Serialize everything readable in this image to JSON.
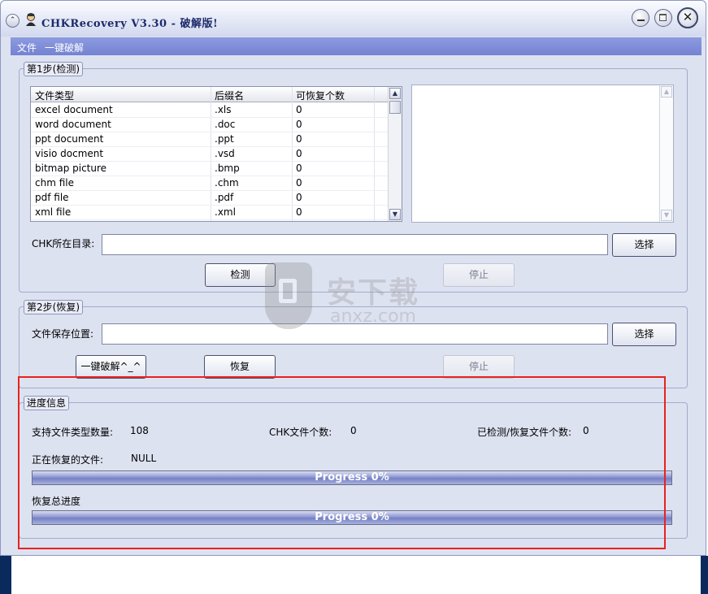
{
  "window": {
    "title": "CHKRecovery V3.30 - 破解版!"
  },
  "menu": {
    "items": [
      "文件",
      "一键破解"
    ]
  },
  "step1": {
    "legend": "第1步(检测)",
    "columns": [
      "文件类型",
      "后缀名",
      "可恢复个数"
    ],
    "rows": [
      [
        "excel document",
        ".xls",
        "0"
      ],
      [
        "word document",
        ".doc",
        "0"
      ],
      [
        "ppt document",
        ".ppt",
        "0"
      ],
      [
        "visio docment",
        ".vsd",
        "0"
      ],
      [
        "bitmap picture",
        ".bmp",
        "0"
      ],
      [
        "chm file",
        ".chm",
        "0"
      ],
      [
        "pdf file",
        ".pdf",
        "0"
      ],
      [
        "xml file",
        ".xml",
        "0"
      ]
    ],
    "dir_label": "CHK所在目录:",
    "dir_value": "",
    "browse_label": "选择",
    "detect_label": "检测",
    "stop_label": "停止"
  },
  "step2": {
    "legend": "第2步(恢复)",
    "save_label": "文件保存位置:",
    "save_value": "",
    "browse_label": "选择",
    "crack_label": "一键破解^_^",
    "recover_label": "恢复",
    "stop_label": "停止"
  },
  "progress": {
    "legend": "进度信息",
    "supported_label": "支持文件类型数量:",
    "supported_value": "108",
    "chk_count_label": "CHK文件个数:",
    "chk_count_value": "0",
    "checked_label": "已检测/恢复文件个数:",
    "checked_value": "0",
    "current_label": "正在恢复的文件:",
    "current_value": "NULL",
    "bar1_text": "Progress 0%",
    "bar1_fraction": 0,
    "total_label": "恢复总进度",
    "bar2_text": "Progress 0%",
    "bar2_fraction": 0
  },
  "watermark": {
    "text": "安下载",
    "sub": "anxz.com"
  },
  "colors": {
    "menubar": "#7b89d8",
    "window_bg": "#dde2f1",
    "highlight": "#e8221f",
    "progress_bar": "#7f8bcc"
  }
}
